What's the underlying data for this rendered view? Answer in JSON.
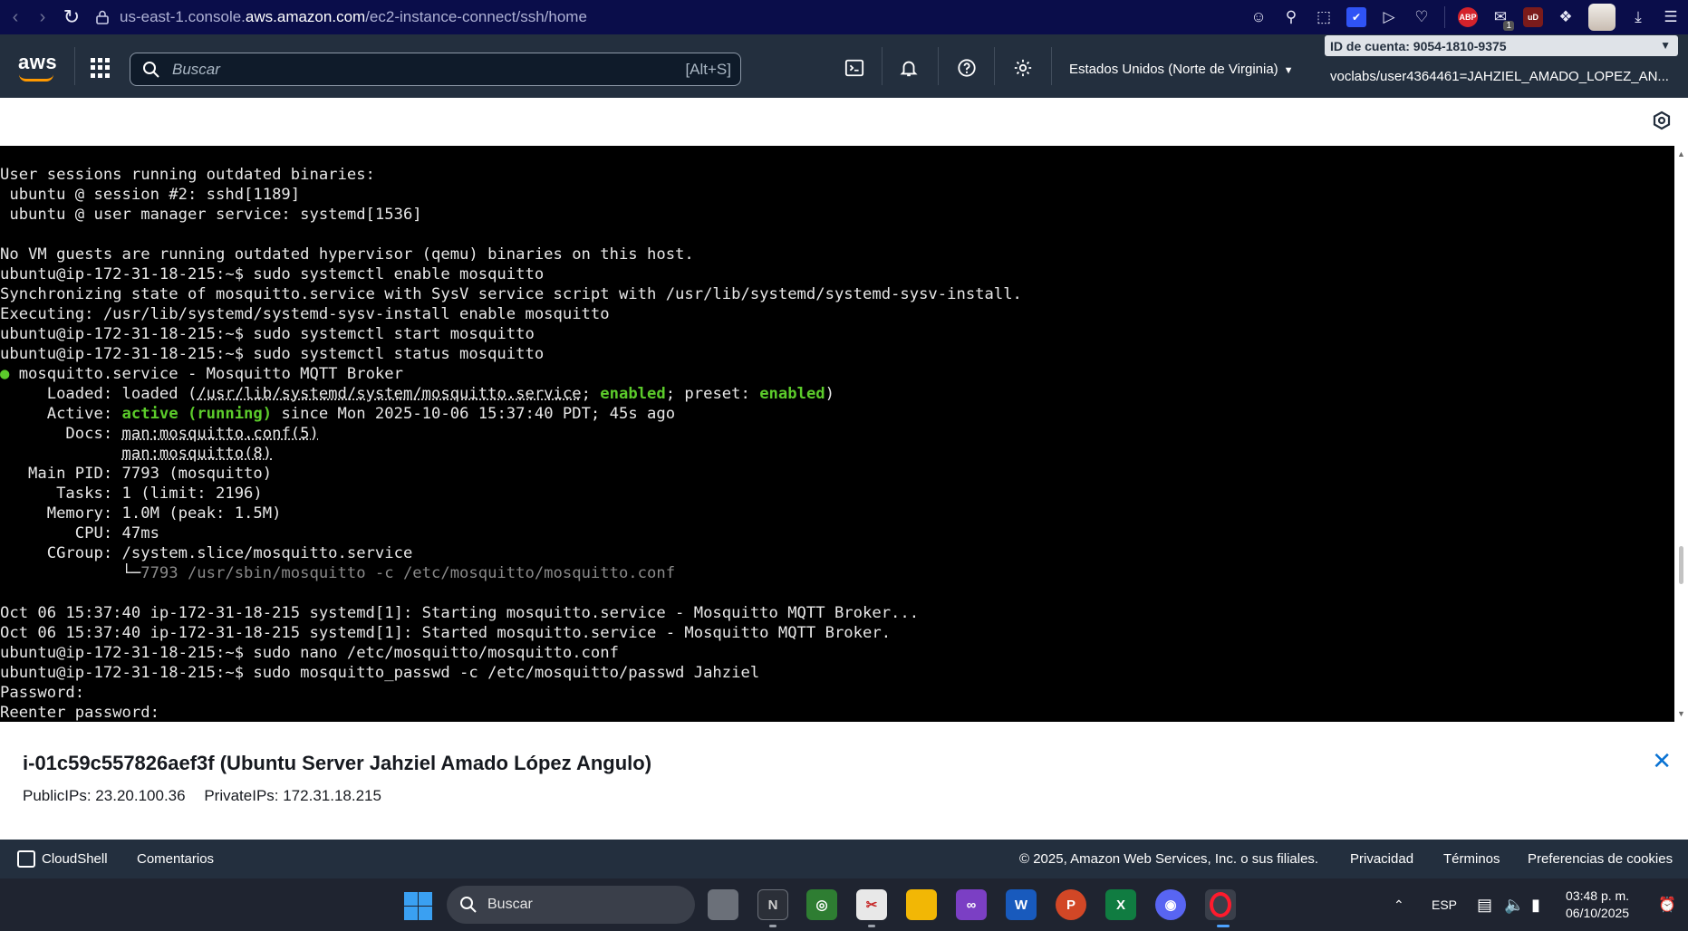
{
  "browser": {
    "url_prefix": "us-east-1.console.",
    "url_host": "aws.amazon.com",
    "url_path": "/ec2-instance-connect/ssh/home",
    "abp_label": "ABP",
    "ub_label": "uD",
    "badge_count": "1"
  },
  "aws_nav": {
    "logo": "aws",
    "search_placeholder": "Buscar",
    "search_shortcut": "[Alt+S]",
    "region": "Estados Unidos (Norte de Virginia)",
    "account_id": "ID de cuenta: 9054-1810-9375",
    "user": "voclabs/user4364461=JAHZIEL_AMADO_LOPEZ_AN..."
  },
  "terminal": {
    "lines": [
      "User sessions running outdated binaries:",
      " ubuntu @ session #2: sshd[1189]",
      " ubuntu @ user manager service: systemd[1536]",
      "",
      "No VM guests are running outdated hypervisor (qemu) binaries on this host.",
      "ubuntu@ip-172-31-18-215:~$ sudo systemctl enable mosquitto",
      "Synchronizing state of mosquitto.service with SysV service script with /usr/lib/systemd/systemd-sysv-install.",
      "Executing: /usr/lib/systemd/systemd-sysv-install enable mosquitto",
      "ubuntu@ip-172-31-18-215:~$ sudo systemctl start mosquitto",
      "ubuntu@ip-172-31-18-215:~$ sudo systemctl status mosquitto"
    ],
    "status": {
      "bullet": "●",
      "service_line": " mosquitto.service - Mosquitto MQTT Broker",
      "loaded_prefix": "     Loaded: loaded (",
      "loaded_path": "/usr/lib/systemd/system/mosquitto.service",
      "loaded_sep": "; ",
      "enabled": "enabled",
      "preset": "; preset: ",
      "preset_value": "enabled",
      "loaded_close": ")",
      "active_prefix": "     Active: ",
      "active_value": "active (running)",
      "active_suffix": " since Mon 2025-10-06 15:37:40 PDT; 45s ago",
      "docs_prefix": "       Docs: ",
      "docs_1": "man:mosquitto.conf(5)",
      "docs_indent": "             ",
      "docs_2": "man:mosquitto(8)",
      "main_pid": "   Main PID: 7793 (mosquitto)",
      "tasks": "      Tasks: 1 (limit: 2196)",
      "memory": "     Memory: 1.0M (peak: 1.5M)",
      "cpu": "        CPU: 47ms",
      "cgroup": "     CGroup: /system.slice/mosquitto.service",
      "cgroup_tree": "             └─",
      "cgroup_proc": "7793 /usr/sbin/mosquitto -c /etc/mosquitto/mosquitto.conf"
    },
    "tail_lines": [
      "",
      "Oct 06 15:37:40 ip-172-31-18-215 systemd[1]: Starting mosquitto.service - Mosquitto MQTT Broker...",
      "Oct 06 15:37:40 ip-172-31-18-215 systemd[1]: Started mosquitto.service - Mosquitto MQTT Broker.",
      "ubuntu@ip-172-31-18-215:~$ sudo nano /etc/mosquitto/mosquitto.conf",
      "ubuntu@ip-172-31-18-215:~$ sudo mosquitto_passwd -c /etc/mosquitto/passwd Jahziel",
      "Password:",
      "Reenter password:"
    ]
  },
  "instance": {
    "title": "i-01c59c557826aef3f (Ubuntu Server Jahziel Amado López Angulo)",
    "public_ips": "PublicIPs: 23.20.100.36",
    "private_ips": "PrivateIPs: 172.31.18.215"
  },
  "footer": {
    "cloudshell": "CloudShell",
    "feedback": "Comentarios",
    "copyright": "© 2025, Amazon Web Services, Inc. o sus filiales.",
    "privacy": "Privacidad",
    "terms": "Términos",
    "cookies": "Preferencias de cookies"
  },
  "taskbar": {
    "search": "Buscar",
    "language": "ESP",
    "time": "03:48 p. m.",
    "date": "06/10/2025",
    "word_label": "W",
    "ppt_label": "P",
    "excel_label": "X",
    "nvidia_label": "N"
  },
  "colors": {
    "browser_bg": "#0a0d4a",
    "aws_nav_bg": "#232f3e",
    "aws_orange": "#ff9900",
    "terminal_bg": "#000000",
    "terminal_green": "#5ccc2b",
    "link_blue": "#0972d3",
    "taskbar_bg": "#1f2430"
  }
}
